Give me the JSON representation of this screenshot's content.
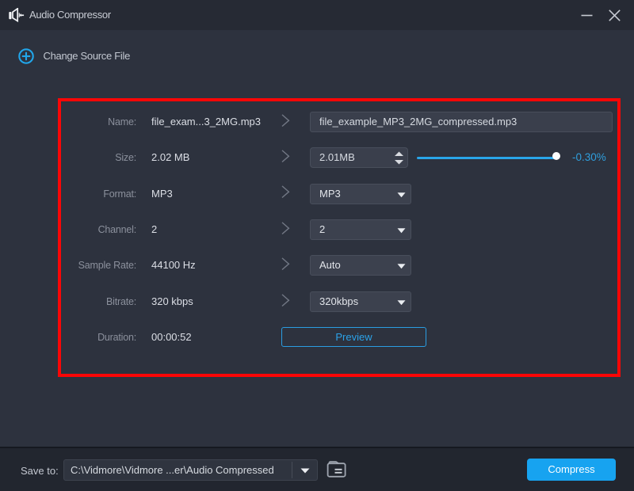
{
  "window": {
    "title": "Audio Compressor",
    "app_icon": "speaker-compress-icon",
    "minimize": "minimize",
    "close": "close"
  },
  "toolbar": {
    "change_source_label": "Change Source File",
    "plus_icon": "plus-circle-icon"
  },
  "panel": {
    "rows": [
      {
        "id": "name",
        "label": "Name:",
        "value": "file_exam...3_2MG.mp3",
        "control": {
          "type": "text",
          "value": "file_example_MP3_2MG_compressed.mp3"
        }
      },
      {
        "id": "size",
        "label": "Size:",
        "value": "2.02 MB",
        "control": {
          "type": "spinner",
          "value": "2.01MB"
        },
        "slider": {
          "percent": 97,
          "label": "-0.30%"
        }
      },
      {
        "id": "format",
        "label": "Format:",
        "value": "MP3",
        "control": {
          "type": "select",
          "value": "MP3"
        }
      },
      {
        "id": "channel",
        "label": "Channel:",
        "value": "2",
        "control": {
          "type": "select",
          "value": "2"
        }
      },
      {
        "id": "sample_rate",
        "label": "Sample Rate:",
        "value": "44100 Hz",
        "control": {
          "type": "select",
          "value": "Auto"
        }
      },
      {
        "id": "bitrate",
        "label": "Bitrate:",
        "value": "320 kbps",
        "control": {
          "type": "select",
          "value": "320kbps"
        }
      },
      {
        "id": "duration",
        "label": "Duration:",
        "value": "00:00:52",
        "control": {
          "type": "button",
          "value": "Preview"
        }
      }
    ]
  },
  "footer": {
    "save_to_label": "Save to:",
    "path_value": "C:\\Vidmore\\Vidmore ...er\\Audio Compressed",
    "folder_icon": "folder-icon",
    "compress_label": "Compress"
  },
  "colors": {
    "accent_blue": "#29a5e9",
    "compress_blue": "#17a3f0",
    "highlight_red": "#fb0606",
    "titlebar_bg": "#242833",
    "body_bg": "#2d323e",
    "footer_bg": "#22262f"
  }
}
